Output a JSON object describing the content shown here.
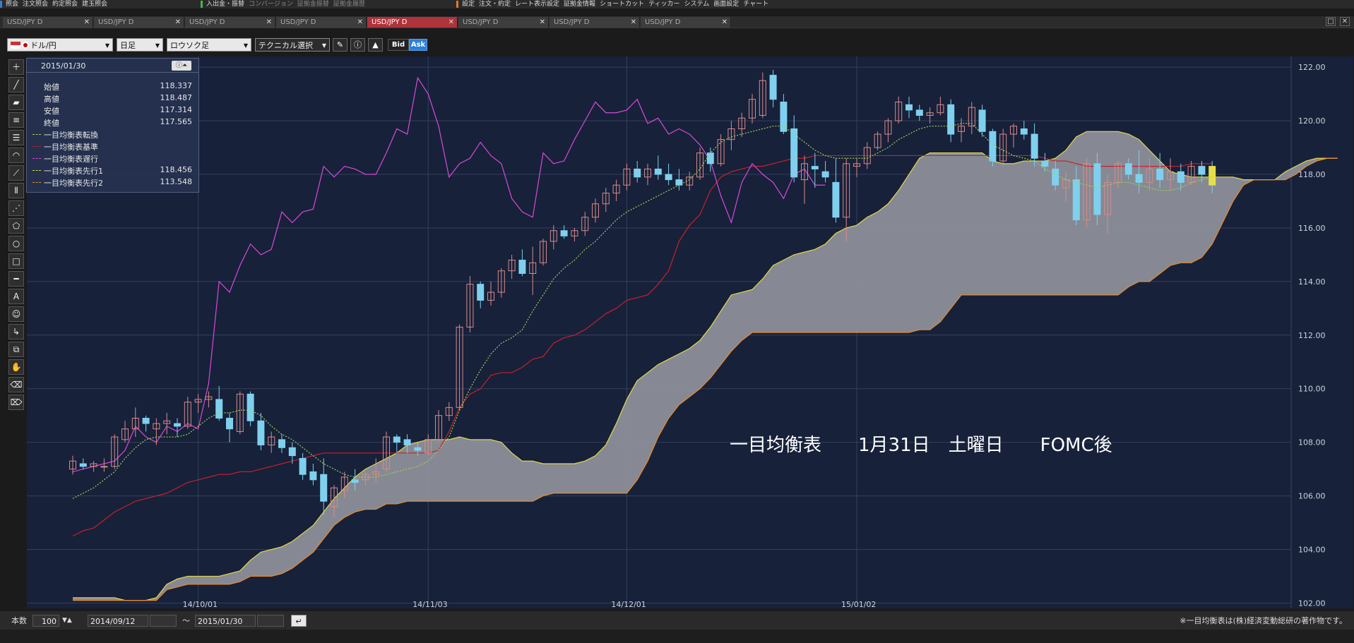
{
  "menubar": {
    "groups": [
      {
        "color": "#3a7bd5",
        "items": [
          "照会",
          "注文照会",
          "約定照会",
          "建玉照会"
        ],
        "dim": [
          false,
          false,
          false,
          false
        ]
      },
      {
        "color": "#47b64a",
        "items": [
          "入出金・振替",
          "コンバージョン",
          "証拠金振替",
          "証拠金履歴"
        ],
        "dim": [
          false,
          true,
          true,
          true
        ]
      },
      {
        "color": "#e07a2a",
        "items": [
          "設定",
          "注文・約定",
          "レート表示設定",
          "証拠金情報",
          "ショートカット",
          "ティッカー",
          "システム",
          "画面設定",
          "チャート"
        ],
        "dim": [
          false,
          false,
          false,
          false,
          false,
          false,
          false,
          false,
          false
        ]
      }
    ]
  },
  "tabs": [
    {
      "label": "USD/JPY D",
      "active": false
    },
    {
      "label": "USD/JPY D",
      "active": false
    },
    {
      "label": "USD/JPY D",
      "active": false
    },
    {
      "label": "USD/JPY D",
      "active": false
    },
    {
      "label": "USD/JPY D",
      "active": true
    },
    {
      "label": "USD/JPY D",
      "active": false
    },
    {
      "label": "USD/JPY D",
      "active": false
    },
    {
      "label": "USD/JPY D",
      "active": false
    }
  ],
  "toolbar": {
    "pair": "ドル/円",
    "period": "日足",
    "chart_type": "ロウソク足",
    "technical": "テクニカル選択",
    "bid": "Bid",
    "ask": "Ask"
  },
  "infobox": {
    "date": "2015/01/30",
    "rows": [
      {
        "label": "始値",
        "value": "118.337",
        "color": ""
      },
      {
        "label": "高値",
        "value": "118.487",
        "color": ""
      },
      {
        "label": "安値",
        "value": "117.314",
        "color": ""
      },
      {
        "label": "終値",
        "value": "117.565",
        "color": ""
      },
      {
        "label": "一目均衡表転換",
        "value": "",
        "color": "#9cd05a"
      },
      {
        "label": "一目均衡表基準",
        "value": "",
        "color": "#c8202a"
      },
      {
        "label": "一目均衡表遅行",
        "value": "",
        "color": "#d84ad8"
      },
      {
        "label": "一目均衡表先行1",
        "value": "118.456",
        "color": "#d8d84a"
      },
      {
        "label": "一目均衡表先行2",
        "value": "113.548",
        "color": "#e8892a"
      }
    ]
  },
  "annotation": "一目均衡表　　1月31日　土曜日　　FOMC後",
  "bottombar": {
    "count_label": "本数",
    "count_value": "100",
    "start_date": "2014/09/12",
    "tilde": "～",
    "end_date": "2015/01/30",
    "copyright": "※一目均衡表は(株)経済変動総研の著作物です。"
  },
  "chart_data": {
    "type": "candlestick",
    "ylim": [
      101.8,
      122.4
    ],
    "yticks": [
      "102.00",
      "104.00",
      "106.00",
      "108.00",
      "110.00",
      "112.00",
      "114.00",
      "116.00",
      "118.00",
      "120.00",
      "122.00"
    ],
    "xticks": [
      {
        "label": "14/10/01",
        "index": 12
      },
      {
        "label": "14/11/03",
        "index": 34
      },
      {
        "label": "14/12/01",
        "index": 53
      },
      {
        "label": "15/01/02",
        "index": 75
      }
    ],
    "candles": [
      [
        107.0,
        107.5,
        106.8,
        107.3
      ],
      [
        107.2,
        107.4,
        107.0,
        107.1
      ],
      [
        107.1,
        107.3,
        106.9,
        107.2
      ],
      [
        107.1,
        107.4,
        106.9,
        107.1
      ],
      [
        107.1,
        108.3,
        107.0,
        108.2
      ],
      [
        108.1,
        108.8,
        108.0,
        108.5
      ],
      [
        108.5,
        109.3,
        108.2,
        108.9
      ],
      [
        108.9,
        109.0,
        108.4,
        108.7
      ],
      [
        108.5,
        108.9,
        107.9,
        108.7
      ],
      [
        108.7,
        109.1,
        108.3,
        108.8
      ],
      [
        108.7,
        108.9,
        108.2,
        108.6
      ],
      [
        108.6,
        109.7,
        108.5,
        109.5
      ],
      [
        109.5,
        109.8,
        109.1,
        109.6
      ],
      [
        109.6,
        109.9,
        109.3,
        109.7
      ],
      [
        109.6,
        110.1,
        108.8,
        108.9
      ],
      [
        108.9,
        109.1,
        108.0,
        108.5
      ],
      [
        108.4,
        109.9,
        108.3,
        109.8
      ],
      [
        109.8,
        109.9,
        108.6,
        108.8
      ],
      [
        108.8,
        109.1,
        107.7,
        107.9
      ],
      [
        107.9,
        108.4,
        107.6,
        108.2
      ],
      [
        108.1,
        108.3,
        107.6,
        107.8
      ],
      [
        107.8,
        108.0,
        107.2,
        107.5
      ],
      [
        107.4,
        107.6,
        106.6,
        106.8
      ],
      [
        106.9,
        107.2,
        106.4,
        106.6
      ],
      [
        106.8,
        107.4,
        105.3,
        105.8
      ],
      [
        105.6,
        106.4,
        105.2,
        106.3
      ],
      [
        106.2,
        106.9,
        105.9,
        106.7
      ],
      [
        106.6,
        107.0,
        106.2,
        106.5
      ],
      [
        106.6,
        106.9,
        106.4,
        106.8
      ],
      [
        106.8,
        107.4,
        106.5,
        106.9
      ],
      [
        107.0,
        108.4,
        106.9,
        108.2
      ],
      [
        108.2,
        108.3,
        107.6,
        108.0
      ],
      [
        108.1,
        108.3,
        107.6,
        107.9
      ],
      [
        107.8,
        108.0,
        107.5,
        107.7
      ],
      [
        107.6,
        108.3,
        107.5,
        108.1
      ],
      [
        108.1,
        109.2,
        108.0,
        109.0
      ],
      [
        109.0,
        109.5,
        108.8,
        109.3
      ],
      [
        109.3,
        112.4,
        109.2,
        112.3
      ],
      [
        112.3,
        114.2,
        112.1,
        113.9
      ],
      [
        113.9,
        114.0,
        113.0,
        113.3
      ],
      [
        113.3,
        114.0,
        113.1,
        113.6
      ],
      [
        113.6,
        114.5,
        113.4,
        114.4
      ],
      [
        114.4,
        115.0,
        114.1,
        114.8
      ],
      [
        114.8,
        115.2,
        114.2,
        114.3
      ],
      [
        114.3,
        115.3,
        113.5,
        114.7
      ],
      [
        114.7,
        115.6,
        114.6,
        115.5
      ],
      [
        115.5,
        116.1,
        115.2,
        115.9
      ],
      [
        115.9,
        116.1,
        115.6,
        115.7
      ],
      [
        115.7,
        116.0,
        115.5,
        115.9
      ],
      [
        115.9,
        116.6,
        115.7,
        116.4
      ],
      [
        116.4,
        117.1,
        116.2,
        116.9
      ],
      [
        116.9,
        117.5,
        116.6,
        117.3
      ],
      [
        117.3,
        117.8,
        117.0,
        117.6
      ],
      [
        117.6,
        118.4,
        117.4,
        118.2
      ],
      [
        118.2,
        118.5,
        117.7,
        117.9
      ],
      [
        117.9,
        118.4,
        117.6,
        118.2
      ],
      [
        118.2,
        118.7,
        117.8,
        118.0
      ],
      [
        118.0,
        118.4,
        117.6,
        117.8
      ],
      [
        117.8,
        118.2,
        117.4,
        117.6
      ],
      [
        117.6,
        118.1,
        117.4,
        117.9
      ],
      [
        117.9,
        119.0,
        117.8,
        118.8
      ],
      [
        118.8,
        119.0,
        118.1,
        118.4
      ],
      [
        118.4,
        119.5,
        118.3,
        119.3
      ],
      [
        119.3,
        120.0,
        118.9,
        119.7
      ],
      [
        119.7,
        120.3,
        119.4,
        120.1
      ],
      [
        120.1,
        121.0,
        119.9,
        120.8
      ],
      [
        120.2,
        121.8,
        120.1,
        121.5
      ],
      [
        121.7,
        121.9,
        120.5,
        120.8
      ],
      [
        120.7,
        121.0,
        119.5,
        119.6
      ],
      [
        119.7,
        120.2,
        117.7,
        117.9
      ],
      [
        117.8,
        118.7,
        116.9,
        118.4
      ],
      [
        118.3,
        118.8,
        117.5,
        118.2
      ],
      [
        118.1,
        118.5,
        117.7,
        117.9
      ],
      [
        117.7,
        118.6,
        116.2,
        116.4
      ],
      [
        116.4,
        118.6,
        115.5,
        118.4
      ],
      [
        118.3,
        118.6,
        117.9,
        118.4
      ],
      [
        118.4,
        119.2,
        118.2,
        119.0
      ],
      [
        119.0,
        119.6,
        118.9,
        119.5
      ],
      [
        119.5,
        120.1,
        119.2,
        120.0
      ],
      [
        120.0,
        120.9,
        119.9,
        120.7
      ],
      [
        120.6,
        120.9,
        120.1,
        120.4
      ],
      [
        120.4,
        120.6,
        120.0,
        120.2
      ],
      [
        120.2,
        120.5,
        119.9,
        120.3
      ],
      [
        120.3,
        120.9,
        120.2,
        120.6
      ],
      [
        120.6,
        120.8,
        119.2,
        119.5
      ],
      [
        119.6,
        120.1,
        119.2,
        119.8
      ],
      [
        119.8,
        120.7,
        119.5,
        120.5
      ],
      [
        120.4,
        120.6,
        119.4,
        119.6
      ],
      [
        119.6,
        119.7,
        118.3,
        118.5
      ],
      [
        118.5,
        119.7,
        118.3,
        119.5
      ],
      [
        119.5,
        119.9,
        119.0,
        119.8
      ],
      [
        119.7,
        120.0,
        119.3,
        119.5
      ],
      [
        119.5,
        119.9,
        118.3,
        118.6
      ],
      [
        118.5,
        118.8,
        118.1,
        118.3
      ],
      [
        118.2,
        118.5,
        117.4,
        117.6
      ],
      [
        117.5,
        118.1,
        117.0,
        117.8
      ],
      [
        117.8,
        118.3,
        116.1,
        116.3
      ],
      [
        116.3,
        118.6,
        116.0,
        118.4
      ],
      [
        118.4,
        118.8,
        116.1,
        116.5
      ],
      [
        116.5,
        118.0,
        115.8,
        117.7
      ],
      [
        117.7,
        118.5,
        117.5,
        118.4
      ],
      [
        118.4,
        118.6,
        117.8,
        118.0
      ],
      [
        118.0,
        118.9,
        117.3,
        117.7
      ],
      [
        117.7,
        118.6,
        117.4,
        118.2
      ],
      [
        118.2,
        118.8,
        117.5,
        117.8
      ],
      [
        117.8,
        118.6,
        117.4,
        118.1
      ],
      [
        118.1,
        118.4,
        117.4,
        117.7
      ],
      [
        117.7,
        118.5,
        117.6,
        118.3
      ],
      [
        118.3,
        118.5,
        117.7,
        118.0
      ],
      [
        118.3,
        118.5,
        117.3,
        117.6
      ]
    ],
    "tenkan": [
      105.9,
      106.1,
      106.3,
      106.6,
      106.9,
      107.4,
      107.8,
      108.1,
      108.2,
      108.2,
      108.2,
      108.3,
      108.6,
      108.9,
      109.1,
      109.1,
      109.2,
      109.2,
      109.0,
      108.6,
      108.3,
      108.1,
      107.8,
      107.5,
      107.2,
      107.0,
      106.8,
      106.7,
      106.7,
      106.7,
      106.8,
      106.9,
      107.0,
      107.1,
      107.3,
      107.7,
      108.2,
      109.2,
      110.0,
      110.7,
      111.3,
      111.7,
      111.9,
      112.2,
      112.9,
      113.5,
      114.1,
      114.5,
      114.8,
      115.2,
      115.5,
      115.9,
      116.3,
      116.6,
      116.8,
      117.0,
      117.2,
      117.4,
      117.6,
      117.8,
      118.2,
      118.8,
      119.2,
      119.4,
      119.5,
      119.6,
      119.7,
      119.8,
      119.8,
      119.5,
      119.2,
      118.9,
      118.7,
      118.6,
      118.6,
      118.6,
      118.6,
      118.8,
      119.0,
      119.3,
      119.5,
      119.7,
      119.8,
      119.8,
      119.8,
      119.9,
      119.9,
      119.5,
      119.1,
      118.9,
      118.7,
      118.6,
      118.5,
      118.2,
      118.0,
      117.8,
      117.7,
      117.6,
      117.5,
      117.6,
      117.7,
      117.7,
      117.6,
      117.5,
      117.4,
      117.4,
      117.5,
      117.7,
      117.8,
      117.9
    ],
    "kijun": [
      104.5,
      104.7,
      104.8,
      105.1,
      105.4,
      105.6,
      105.8,
      105.9,
      106.0,
      106.1,
      106.3,
      106.5,
      106.6,
      106.7,
      106.8,
      106.8,
      106.9,
      106.9,
      107.0,
      107.1,
      107.2,
      107.3,
      107.4,
      107.5,
      107.6,
      107.6,
      107.6,
      107.6,
      107.6,
      107.6,
      107.6,
      107.6,
      107.6,
      107.6,
      107.6,
      107.7,
      108.4,
      109.3,
      109.8,
      110.0,
      110.5,
      110.6,
      110.6,
      110.8,
      111.1,
      111.2,
      111.7,
      111.9,
      112.0,
      112.2,
      112.5,
      112.8,
      113.0,
      113.3,
      113.4,
      113.5,
      113.9,
      114.4,
      115.5,
      116.1,
      116.5,
      117.4,
      117.9,
      118.1,
      118.2,
      118.3,
      118.3,
      118.4,
      118.5,
      118.6,
      118.6,
      118.7,
      118.7,
      118.7,
      118.7,
      118.7,
      118.7,
      118.7,
      118.7,
      118.7,
      118.7,
      118.7,
      118.7,
      118.7,
      118.7,
      118.7,
      118.7,
      118.7,
      118.7,
      118.7,
      118.7,
      118.7,
      118.7,
      118.6,
      118.5,
      118.5,
      118.4,
      118.3,
      118.3,
      118.3,
      118.3,
      118.3,
      118.3,
      118.3,
      118.3,
      118.3,
      118.3,
      118.4,
      118.4,
      118.4
    ],
    "chikou": [
      106.9,
      107.0,
      107.1,
      107.2,
      107.3,
      107.7,
      108.6,
      108.2,
      108.0,
      108.6,
      108.4,
      108.7,
      108.5,
      110.2,
      114.0,
      113.6,
      114.6,
      115.4,
      115.0,
      115.2,
      116.6,
      116.2,
      116.6,
      116.7,
      118.3,
      117.9,
      118.3,
      118.2,
      118.0,
      118.0,
      118.8,
      119.7,
      119.5,
      121.6,
      121.0,
      119.8,
      117.9,
      118.4,
      118.6,
      119.2,
      118.7,
      118.4,
      117.1,
      116.6,
      116.4,
      118.8,
      118.4,
      118.5,
      119.3,
      120.0,
      120.7,
      120.3,
      120.3,
      120.4,
      120.8,
      119.9,
      120.1,
      119.5,
      119.7,
      119.5,
      119.1,
      118.5,
      117.2,
      116.2,
      117.7,
      118.4,
      118.0,
      117.7,
      117.1,
      118.0,
      118.2,
      117.6,
      117.6
    ],
    "senkou_a": [
      102.2,
      102.2,
      102.2,
      102.2,
      102.2,
      102.1,
      102.1,
      102.1,
      102.2,
      102.7,
      102.9,
      103.0,
      103.0,
      103.0,
      103.0,
      103.1,
      103.2,
      103.6,
      103.9,
      104.0,
      104.1,
      104.3,
      104.6,
      104.9,
      105.4,
      105.9,
      106.3,
      106.7,
      107.0,
      107.2,
      107.4,
      107.6,
      107.9,
      108.0,
      108.1,
      108.1,
      108.1,
      108.2,
      108.1,
      108.1,
      108.1,
      108.0,
      107.6,
      107.3,
      107.3,
      107.2,
      107.2,
      107.2,
      107.2,
      107.3,
      107.5,
      107.9,
      108.7,
      109.6,
      110.3,
      110.6,
      110.9,
      111.1,
      111.3,
      111.5,
      111.8,
      112.3,
      112.9,
      113.5,
      113.6,
      113.7,
      114.1,
      114.6,
      114.8,
      115.0,
      115.1,
      115.2,
      115.4,
      115.8,
      116.0,
      116.1,
      116.4,
      116.6,
      116.9,
      117.4,
      118.0,
      118.6,
      118.8,
      118.8,
      118.8,
      118.8,
      118.8,
      118.8,
      118.5,
      118.4,
      118.4,
      118.5,
      118.5,
      118.5,
      118.6,
      118.9,
      119.4,
      119.6,
      119.6,
      119.6,
      119.6,
      119.5,
      119.3,
      118.9,
      118.5,
      118.1,
      118.0,
      117.9,
      117.9,
      117.9,
      117.9,
      117.9,
      117.8,
      117.8,
      117.8,
      117.8,
      118.1,
      118.3,
      118.5,
      118.6,
      118.6,
      118.6
    ],
    "senkou_b": [
      102.1,
      102.1,
      102.1,
      102.1,
      102.1,
      102.1,
      102.1,
      102.1,
      102.1,
      102.5,
      102.6,
      102.7,
      102.7,
      102.7,
      102.7,
      102.7,
      102.8,
      103.0,
      103.0,
      103.0,
      103.1,
      103.3,
      103.6,
      103.9,
      104.4,
      104.9,
      105.2,
      105.4,
      105.5,
      105.5,
      105.7,
      105.7,
      105.8,
      105.8,
      105.8,
      105.8,
      105.8,
      105.8,
      105.8,
      105.8,
      105.8,
      105.8,
      105.8,
      105.8,
      105.8,
      106.0,
      106.1,
      106.1,
      106.1,
      106.1,
      106.1,
      106.1,
      106.1,
      106.1,
      106.6,
      107.3,
      108.2,
      108.9,
      109.4,
      109.7,
      110.0,
      110.4,
      110.9,
      111.4,
      111.8,
      112.1,
      112.1,
      112.1,
      112.1,
      112.1,
      112.1,
      112.1,
      112.1,
      112.1,
      112.1,
      112.1,
      112.1,
      112.1,
      112.1,
      112.1,
      112.1,
      112.2,
      112.2,
      112.5,
      113.0,
      113.5,
      113.5,
      113.5,
      113.5,
      113.5,
      113.5,
      113.5,
      113.5,
      113.5,
      113.5,
      113.5,
      113.5,
      113.5,
      113.5,
      113.5,
      113.5,
      113.8,
      114.0,
      114.0,
      114.3,
      114.6,
      114.7,
      114.7,
      114.9,
      115.4,
      116.2,
      117.0,
      117.6,
      117.8,
      117.8,
      117.8,
      117.8,
      118.0,
      118.3,
      118.5,
      118.6,
      118.6
    ]
  }
}
